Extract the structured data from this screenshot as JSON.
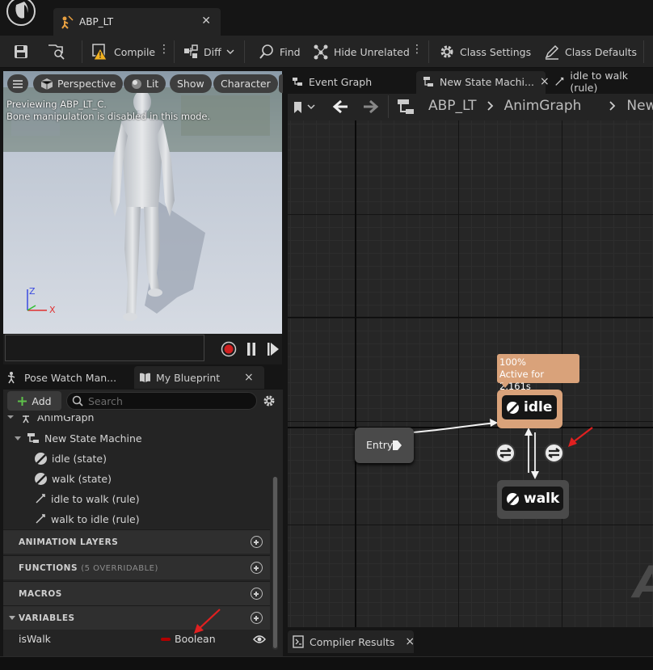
{
  "window": {
    "document_tab": "ABP_LT"
  },
  "toolbar": {
    "compile": "Compile",
    "diff": "Diff",
    "find": "Find",
    "hide_unrelated": "Hide Unrelated",
    "class_settings": "Class Settings",
    "class_defaults": "Class Defaults"
  },
  "viewport": {
    "perspective": "Perspective",
    "lit": "Lit",
    "show": "Show",
    "character": "Character",
    "preview_line1": "Previewing ABP_LT_C.",
    "preview_line2": "Bone manipulation is disabled in this mode.",
    "axis_z": "Z",
    "axis_x": "X"
  },
  "left_tabs": {
    "pose_watch": "Pose Watch Man...",
    "my_blueprint": "My Blueprint",
    "close": "×"
  },
  "my_blueprint": {
    "add_label": "Add",
    "search_placeholder": "Search",
    "tree": {
      "anim_graph": "AnimGraph",
      "state_machine": "New State Machine",
      "items": [
        "idle (state)",
        "walk (state)",
        "idle to walk (rule)",
        "walk to idle (rule)"
      ]
    },
    "sections": {
      "animation_layers": "ANIMATION LAYERS",
      "functions": "FUNCTIONS",
      "functions_sub": "(5 OVERRIDABLE)",
      "macros": "MACROS",
      "variables": "VARIABLES"
    },
    "variable": {
      "name": "isWalk",
      "type": "Boolean",
      "type_color": "#b00000"
    }
  },
  "graph_tabs": {
    "event_graph": "Event Graph",
    "state_machine": "New State Machi...",
    "rule": "idle to walk (rule)",
    "close": "×"
  },
  "breadcrumb": {
    "root": "ABP_LT",
    "graph": "AnimGraph",
    "next": "New"
  },
  "graph": {
    "entry": "Entry",
    "tooltip_line1": "100%",
    "tooltip_line2": "Active for 2.161s",
    "idle": "idle",
    "walk": "walk",
    "active_color": "#d9a27a",
    "watermark": "A"
  },
  "bottom": {
    "compiler_results": "Compiler Results",
    "close": "×"
  }
}
